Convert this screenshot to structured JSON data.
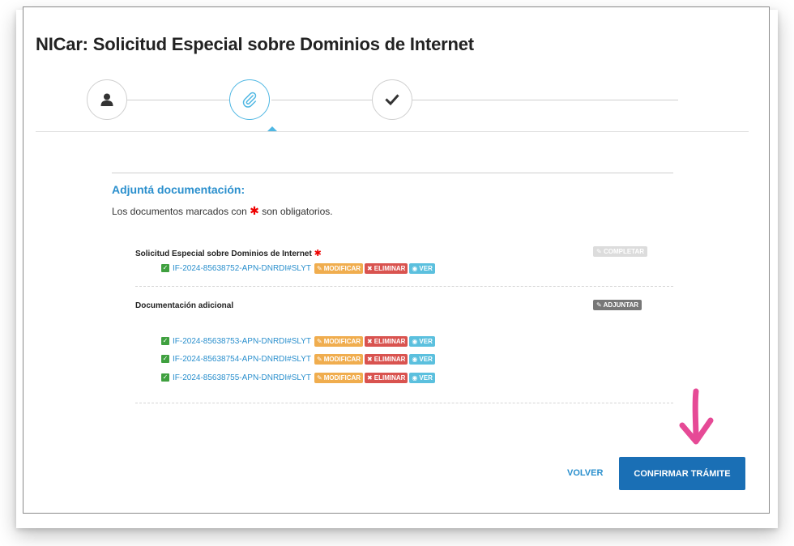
{
  "page": {
    "title": "NICar: Solicitud Especial sobre Dominios de Internet"
  },
  "steps": [
    {
      "icon": "user-icon",
      "state": "done"
    },
    {
      "icon": "paperclip-icon",
      "state": "active"
    },
    {
      "icon": "checkmark-icon",
      "state": "pending"
    }
  ],
  "section": {
    "heading": "Adjuntá documentación:",
    "note_before": "Los documentos marcados con",
    "note_after": "son obligatorios.",
    "required_mark": "✱"
  },
  "documents": [
    {
      "title": "Solicitud Especial sobre Dominios de Internet",
      "required": true,
      "action_label": "COMPLETAR",
      "action_icon": "pencil-icon",
      "files": [
        "IF-2024-85638752-APN-DNRDI#SLYT"
      ]
    },
    {
      "title": "Documentación adicional",
      "required": false,
      "action_label": "ADJUNTAR",
      "action_icon": "tag-icon",
      "files": [
        "IF-2024-85638753-APN-DNRDI#SLYT",
        "IF-2024-85638754-APN-DNRDI#SLYT",
        "IF-2024-85638755-APN-DNRDI#SLYT"
      ]
    }
  ],
  "file_actions": {
    "modify": "MODIFICAR",
    "delete": "ELIMINAR",
    "view": "VER"
  },
  "footer": {
    "back_label": "VOLVER",
    "confirm_label": "CONFIRMAR TRÁMITE"
  },
  "colors": {
    "link": "#2a8fcd",
    "primary": "#1a6fb5",
    "highlight_arrow": "#e64a96"
  }
}
